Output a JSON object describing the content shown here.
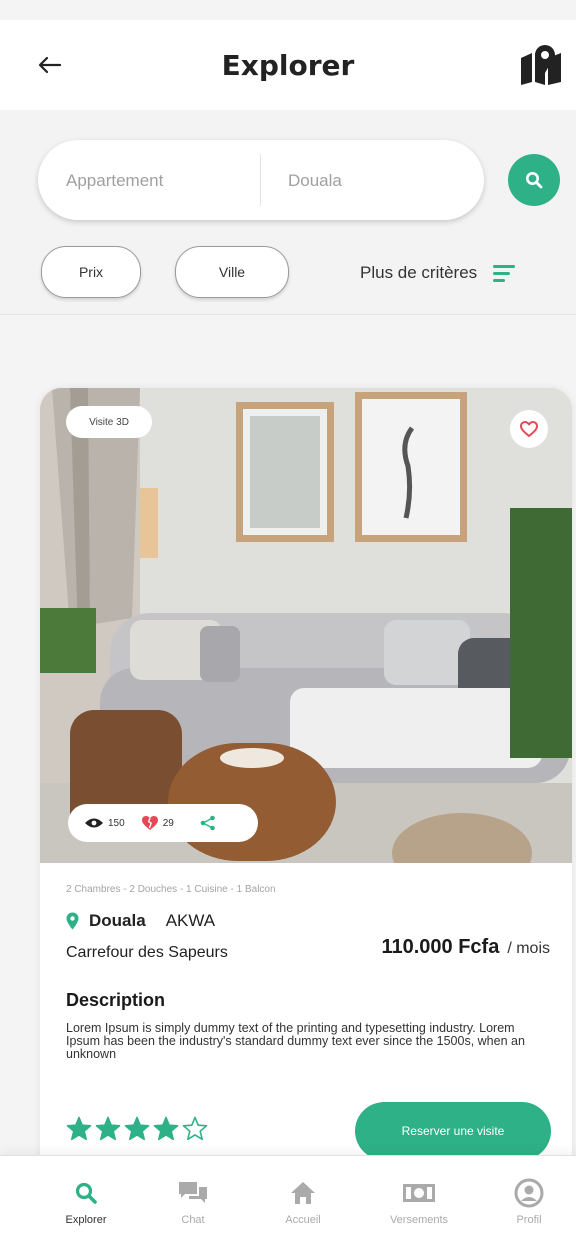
{
  "header": {
    "title": "Explorer",
    "back_icon": "arrow-left-icon",
    "map_icon": "map-pin-icon"
  },
  "search": {
    "type_placeholder": "Appartement",
    "city_placeholder": "Douala",
    "button_icon": "search-icon"
  },
  "filters": {
    "chips": [
      "Prix",
      "Ville"
    ],
    "more_label": "Plus de critères"
  },
  "listing": {
    "badge_3d": "Visite 3D",
    "views": "150",
    "likes": "29",
    "features": "2 Chambres - 2 Douches - 1 Cuisine - 1 Balcon",
    "city": "Douala",
    "district": "AKWA",
    "address": "Carrefour des Sapeurs",
    "price": "110.000 Fcfa",
    "price_unit": "/ mois",
    "description_title": "Description",
    "description": "Lorem Ipsum is simply dummy text of the printing and typesetting industry. Lorem Ipsum has been the industry's standard dummy text ever since the 1500s, when an unknown",
    "rating": 4,
    "rating_max": 5,
    "reserve_label": "Reserver une visite"
  },
  "nav": {
    "items": [
      {
        "label": "Explorer",
        "icon": "search-icon",
        "active": true
      },
      {
        "label": "Chat",
        "icon": "chat-icon",
        "active": false
      },
      {
        "label": "Accueil",
        "icon": "home-icon",
        "active": false
      },
      {
        "label": "Versements",
        "icon": "cash-icon",
        "active": false
      },
      {
        "label": "Profil",
        "icon": "profile-icon",
        "active": false
      }
    ]
  },
  "colors": {
    "accent": "#2fb187",
    "heart": "#e84855"
  }
}
